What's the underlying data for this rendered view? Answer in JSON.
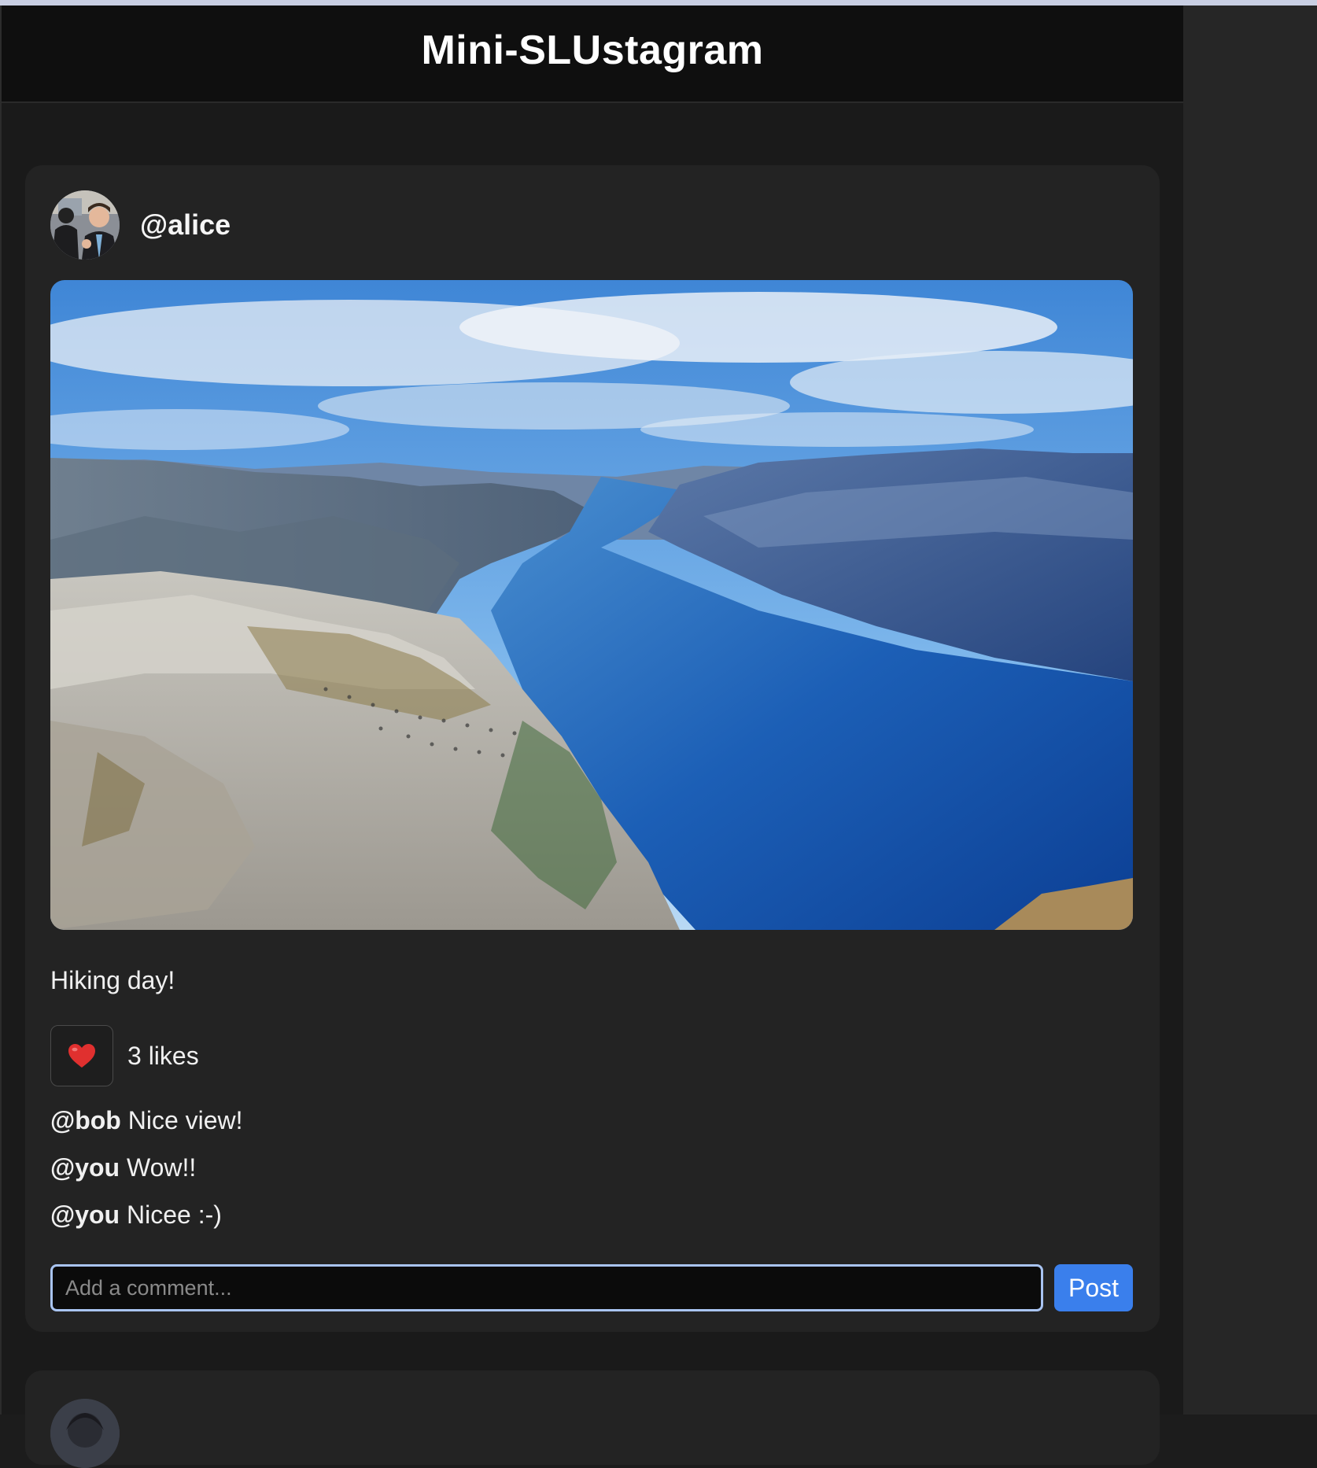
{
  "app": {
    "title": "Mini-SLUstagram"
  },
  "posts": [
    {
      "username": "@alice",
      "avatar_icon": "user-avatar-photo",
      "photo_icon": "fjord-landscape-photo",
      "caption": "Hiking day!",
      "like_icon": "heart-icon",
      "likes_label": "3 likes",
      "comments": [
        {
          "author": "@bob",
          "text": "Nice view!"
        },
        {
          "author": "@you",
          "text": "Wow!!"
        },
        {
          "author": "@you",
          "text": "Nicee :-)"
        }
      ],
      "comment_input": {
        "value": "",
        "placeholder": "Add a comment..."
      },
      "post_button_label": "Post"
    }
  ],
  "colors": {
    "header_bg": "#0f0f0f",
    "card_bg": "#232323",
    "accent": "#3a7fec",
    "input_focus_border": "#a9c4f2",
    "heart": "#e0302f"
  }
}
